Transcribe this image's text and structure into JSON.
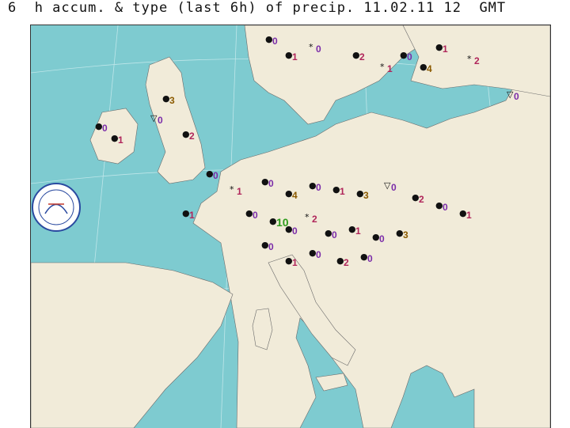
{
  "title": "6  h accum. & type (last 6h) of precip. 11.02.11 12  GMT",
  "colors": {
    "sea": "#7ecbd0",
    "land": "#f1ebd9",
    "zero": "#7a2ba8",
    "small": "#b0255a",
    "mid": "#8b5a00",
    "large": "#2e9b1c"
  },
  "stations": [
    {
      "v": "0",
      "sym": "dot"
    },
    {
      "v": "1",
      "sym": "dot"
    },
    {
      "v": "0",
      "sym": "snow"
    },
    {
      "v": "2",
      "sym": "dot"
    },
    {
      "v": "1",
      "sym": "snow"
    },
    {
      "v": "0",
      "sym": "dot"
    },
    {
      "v": "4",
      "sym": "dot"
    },
    {
      "v": "1",
      "sym": "dot"
    },
    {
      "v": "2",
      "sym": "snow"
    },
    {
      "v": "0",
      "sym": "shower"
    },
    {
      "v": "3",
      "sym": "dot"
    },
    {
      "v": "0",
      "sym": "dot"
    },
    {
      "v": "1",
      "sym": "dot"
    },
    {
      "v": "0",
      "sym": "shower"
    },
    {
      "v": "2",
      "sym": "dot"
    },
    {
      "v": "0",
      "sym": "dot"
    },
    {
      "v": "1",
      "sym": "snow"
    },
    {
      "v": "0",
      "sym": "dot"
    },
    {
      "v": "4",
      "sym": "dot"
    },
    {
      "v": "0",
      "sym": "dot"
    },
    {
      "v": "1",
      "sym": "dot"
    },
    {
      "v": "3",
      "sym": "dot"
    },
    {
      "v": "0",
      "sym": "shower"
    },
    {
      "v": "2",
      "sym": "dot"
    },
    {
      "v": "0",
      "sym": "dot"
    },
    {
      "v": "1",
      "sym": "dot"
    },
    {
      "v": "0",
      "sym": "dot"
    },
    {
      "v": "10",
      "sym": "dot"
    },
    {
      "v": "0",
      "sym": "dot"
    },
    {
      "v": "2",
      "sym": "snow"
    },
    {
      "v": "0",
      "sym": "dot"
    },
    {
      "v": "1",
      "sym": "dot"
    },
    {
      "v": "0",
      "sym": "dot"
    },
    {
      "v": "3",
      "sym": "dot"
    },
    {
      "v": "0",
      "sym": "dot"
    },
    {
      "v": "1",
      "sym": "dot"
    },
    {
      "v": "0",
      "sym": "dot"
    },
    {
      "v": "2",
      "sym": "dot"
    },
    {
      "v": "0",
      "sym": "dot"
    },
    {
      "v": "1",
      "sym": "dot"
    }
  ]
}
